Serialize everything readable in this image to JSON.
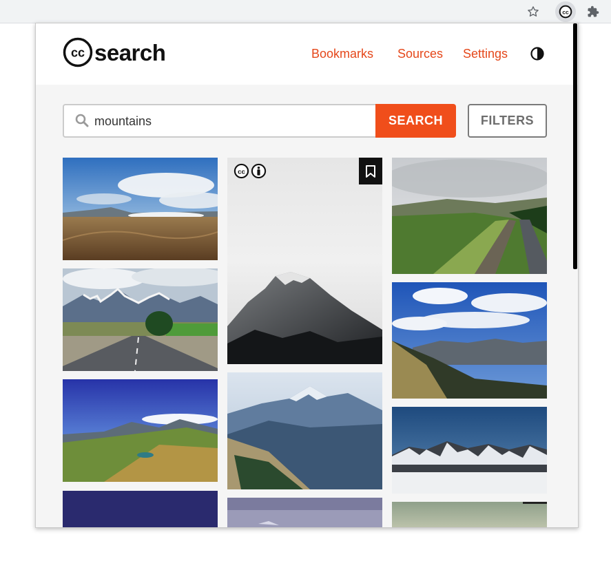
{
  "browser": {
    "toolbar_icons": [
      "star-icon",
      "cc-extension-icon",
      "puzzle-extensions-icon"
    ]
  },
  "header": {
    "logo_text": "search",
    "logo_icon": "cc-logo-icon",
    "nav": {
      "bookmarks": "Bookmarks",
      "sources": "Sources",
      "settings": "Settings"
    },
    "theme_icon": "contrast-toggle-icon"
  },
  "search": {
    "value": "mountains",
    "button_label": "SEARCH",
    "filters_label": "FILTERS"
  },
  "gallery": {
    "hovered_image": {
      "license_icons": [
        "cc-icon",
        "by-attribution-icon"
      ],
      "bookmark_icon": "bookmark-icon"
    }
  },
  "colors": {
    "accent": "#f04e1b",
    "link": "#e5471a"
  }
}
